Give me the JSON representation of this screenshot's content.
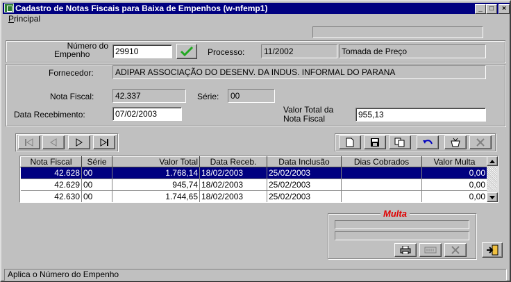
{
  "window": {
    "title": "Cadastro de Notas Fiscais para Baixa de Empenhos  (w-nfemp1)",
    "controls": [
      "_",
      "□",
      "×"
    ]
  },
  "menu": {
    "principal_first": "P",
    "principal_rest": "rincipal"
  },
  "empenho": {
    "label_line1": "Número do",
    "label_line2": "Empenho",
    "value": "29910"
  },
  "processo": {
    "label": "Processo:",
    "value": "11/2002",
    "modalidade": "Tomada de Preço"
  },
  "fornecedor": {
    "label": "Fornecedor:",
    "value": "ADIPAR ASSOCIAÇÃO DO DESENV. DA INDUS. INFORMAL DO PARANA"
  },
  "nota": {
    "label": "Nota Fiscal:",
    "value": "42.337"
  },
  "serie": {
    "label": "Série:",
    "value": "00"
  },
  "recebimento": {
    "label": "Data Recebimento:",
    "value": "07/02/2003"
  },
  "valor_total": {
    "label_line1": "Valor Total da",
    "label_line2": "Nota Fiscal",
    "value": "955,13"
  },
  "table": {
    "columns": [
      "Nota Fiscal",
      "Série",
      "Valor Total",
      "Data Receb.",
      "Data Inclusão",
      "Dias Cobrados",
      "Valor Multa"
    ],
    "rows": [
      [
        "42.628",
        "00",
        "1.768,14",
        "18/02/2003",
        "25/02/2003",
        "",
        "0,00"
      ],
      [
        "42.629",
        "00",
        "945,74",
        "18/02/2003",
        "25/02/2003",
        "",
        "0,00"
      ],
      [
        "42.630",
        "00",
        "1.744,65",
        "18/02/2003",
        "25/02/2003",
        "",
        "0,00"
      ]
    ]
  },
  "multa": {
    "label": "Multa",
    "accent": "#e00000"
  },
  "status": {
    "text": "Aplica o Número do Empenho"
  },
  "colors": {
    "title_bg": "#000080",
    "face": "#c0c0c0",
    "check": "#22a822",
    "selection": "#000080"
  }
}
